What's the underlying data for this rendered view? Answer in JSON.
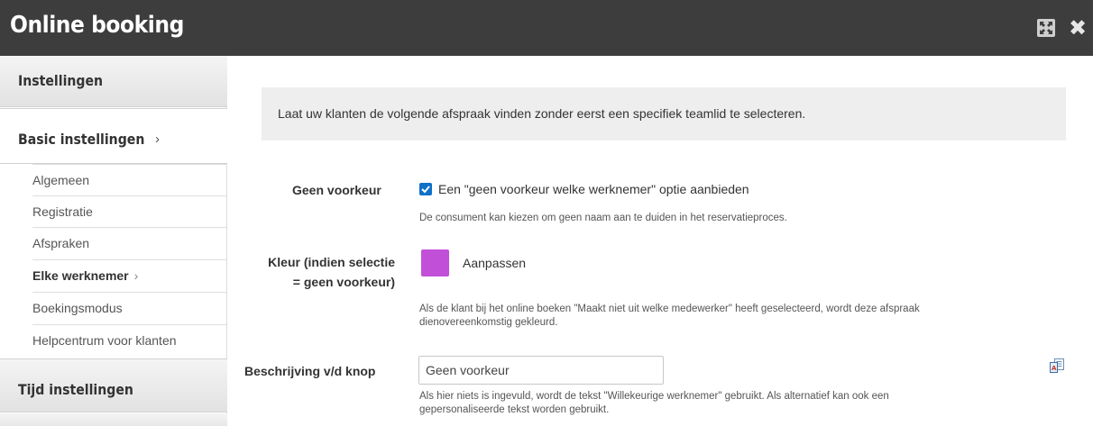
{
  "window": {
    "title": "Online booking",
    "expand_icon": "expand-icon",
    "close_icon": "close-icon",
    "close_glyph": "✖"
  },
  "sidebar": {
    "section_settings": "Instellingen",
    "section_basic": "Basic instellingen",
    "section_basic_chevron": "›",
    "items": [
      {
        "label": "Algemeen"
      },
      {
        "label": "Registratie"
      },
      {
        "label": "Afspraken"
      },
      {
        "label": "Elke werknemer",
        "chevron": "›",
        "active": true
      },
      {
        "label": "Boekingsmodus"
      },
      {
        "label": "Helpcentrum voor klanten"
      }
    ],
    "section_time": "Tijd instellingen"
  },
  "main": {
    "info_text": "Laat uw klanten de volgende afspraak vinden zonder eerst een specifiek teamlid te selecteren.",
    "no_preference": {
      "label": "Geen voorkeur",
      "checkbox_checked": true,
      "checkbox_label": "Een \"geen voorkeur welke werknemer\" optie aanbieden",
      "help": "De consument kan kiezen om geen naam aan te duiden in het reservatieproces."
    },
    "color": {
      "label_line1": "Kleur (indien selectie",
      "label_line2": "= geen voorkeur)",
      "swatch_color": "#c24fd8",
      "button_label": "Aanpassen",
      "help_line1": "Als de klant bij het online boeken \"Maakt niet uit welke medewerker\" heeft geselecteerd, wordt deze afspraak",
      "help_line2": "dienovereenkomstig gekleurd."
    },
    "button_description": {
      "label": "Beschrijving v/d knop",
      "value": "Geen voorkeur",
      "help_line1": "Als hier niets is ingevuld, wordt de tekst \"Willekeurige werknemer\" gebruikt. Als alternatief kan ook een",
      "help_line2": "gepersonaliseerde tekst worden gebruikt.",
      "side_icon": "translate-icon"
    }
  },
  "colors": {
    "titlebar": "#3d3d3d",
    "checkbox": "#0f70c8",
    "info_box": "#eeeeee"
  }
}
